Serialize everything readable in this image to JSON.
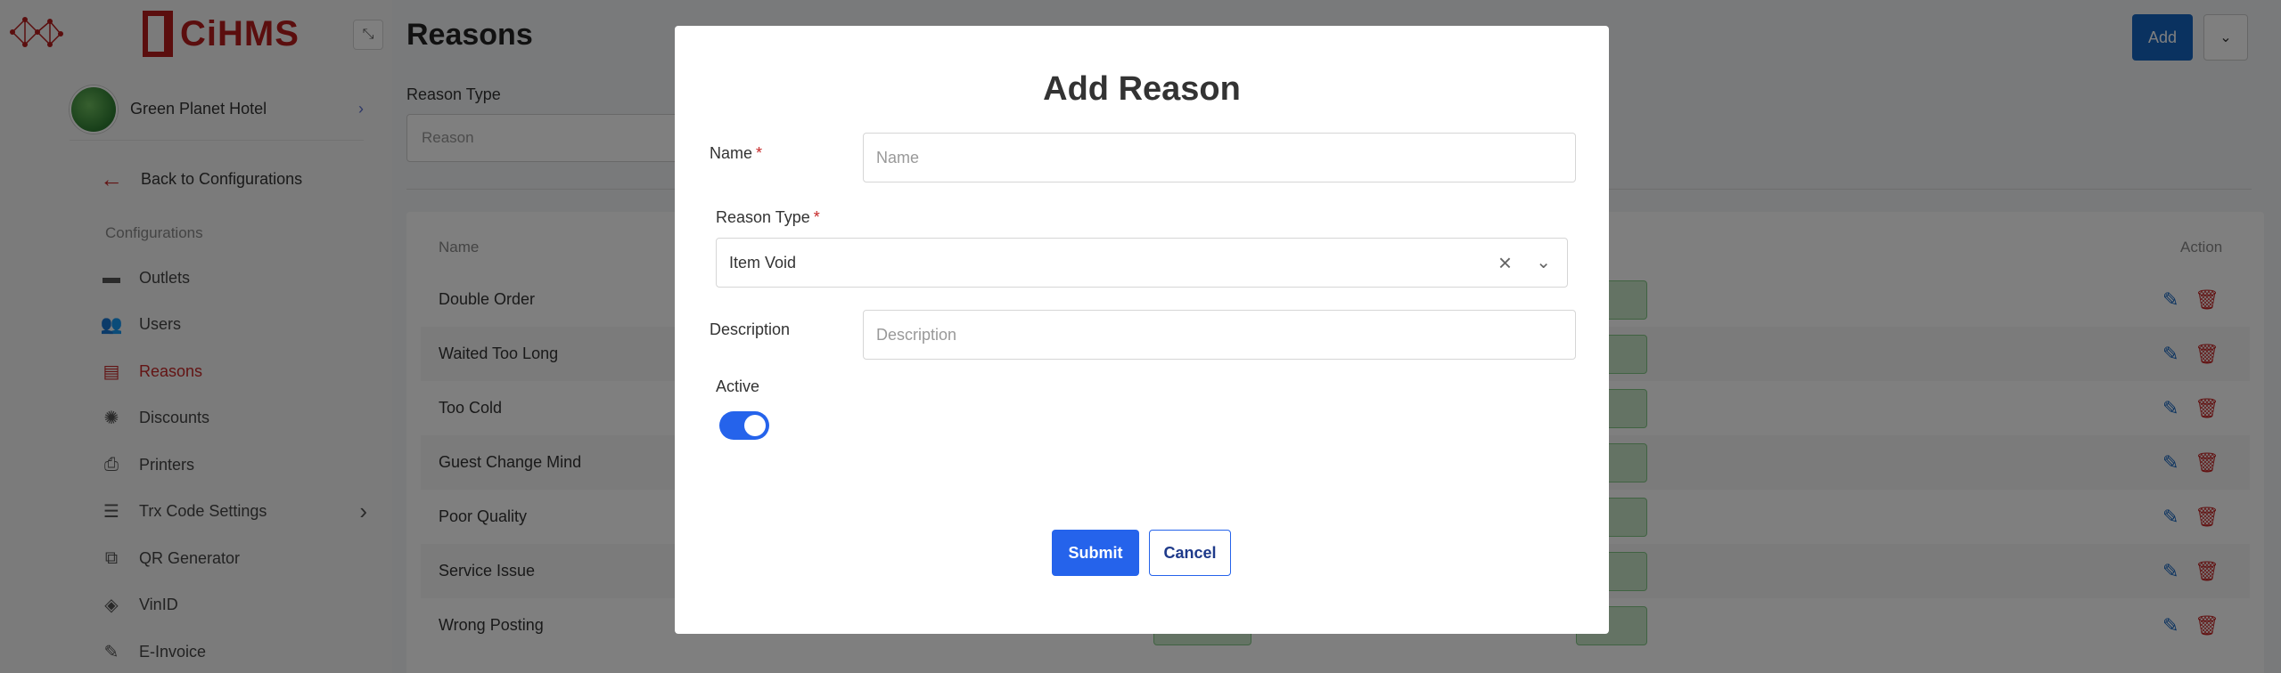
{
  "sidebar": {
    "brand": "CiHMS",
    "hotel_name": "Green Planet Hotel",
    "back_label": "Back to Configurations",
    "section_title": "Configurations",
    "items": [
      {
        "label": "Outlets",
        "icon": "outlet-icon"
      },
      {
        "label": "Users",
        "icon": "users-icon"
      },
      {
        "label": "Reasons",
        "icon": "comment-icon"
      },
      {
        "label": "Discounts",
        "icon": "discount-icon"
      },
      {
        "label": "Printers",
        "icon": "printer-icon"
      },
      {
        "label": "Trx Code Settings",
        "icon": "list-icon"
      },
      {
        "label": "QR Generator",
        "icon": "qr-icon"
      },
      {
        "label": "VinID",
        "icon": "vinid-icon"
      },
      {
        "label": "E-Invoice",
        "icon": "invoice-icon"
      }
    ]
  },
  "main": {
    "title": "Reasons",
    "add_label": "Add",
    "filter_label": "Reason Type",
    "filter_placeholder": "Reason",
    "col_name": "Name",
    "col_action": "Action",
    "rows": [
      "Double Order",
      "Waited Too Long",
      "Too Cold",
      "Guest Change Mind",
      "Poor Quality",
      "Service Issue",
      "Wrong Posting"
    ]
  },
  "modal": {
    "title": "Add Reason",
    "name_label": "Name",
    "name_placeholder": "Name",
    "type_label": "Reason Type",
    "type_value": "Item Void",
    "description_label": "Description",
    "description_placeholder": "Description",
    "active_label": "Active",
    "active": true,
    "required_mark": "*",
    "submit_label": "Submit",
    "cancel_label": "Cancel"
  },
  "colors": {
    "primary": "#2563eb",
    "brand_red": "#b71c1c",
    "active_red": "#c62828"
  }
}
